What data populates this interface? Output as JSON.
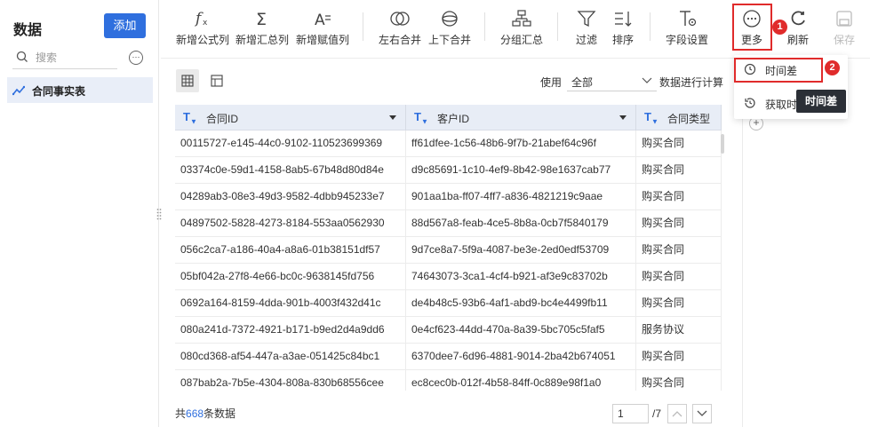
{
  "sidebar": {
    "title": "数据",
    "add_label": "添加",
    "search_placeholder": "搜索",
    "more_glyph": "···",
    "item_label": "合同事实表"
  },
  "toolbar": {
    "new_formula": "新增公式列",
    "new_summary": "新增汇总列",
    "new_assign": "新增赋值列",
    "lr_merge": "左右合并",
    "ud_merge": "上下合并",
    "group_summary": "分组汇总",
    "filter": "过滤",
    "sort": "排序",
    "field_settings": "字段设置",
    "more": "更多",
    "refresh": "刷新",
    "save": "保存"
  },
  "badges": {
    "b1": "1",
    "b2": "2"
  },
  "dropdown": {
    "time_diff": "时间差",
    "get_time": "获取时间"
  },
  "tooltip": "时间差",
  "filter_bar": {
    "use_label": "使用",
    "select_value": "全部",
    "calc_label": "数据进行计算"
  },
  "table": {
    "type_glyph": "T",
    "headers": [
      "合同ID",
      "客户ID",
      "合同类型"
    ],
    "rows": [
      [
        "00115727-e145-44c0-9102-110523699369",
        "ff61dfee-1c56-48b6-9f7b-21abef64c96f",
        "购买合同"
      ],
      [
        "03374c0e-59d1-4158-8ab5-67b48d80d84e",
        "d9c85691-1c10-4ef9-8b42-98e1637cab77",
        "购买合同"
      ],
      [
        "04289ab3-08e3-49d3-9582-4dbb945233e7",
        "901aa1ba-ff07-4ff7-a836-4821219c9aae",
        "购买合同"
      ],
      [
        "04897502-5828-4273-8184-553aa0562930",
        "88d567a8-feab-4ce5-8b8a-0cb7f5840179",
        "购买合同"
      ],
      [
        "056c2ca7-a186-40a4-a8a6-01b38151df57",
        "9d7ce8a7-5f9a-4087-be3e-2ed0edf53709",
        "购买合同"
      ],
      [
        "05bf042a-27f8-4e66-bc0c-9638145fd756",
        "74643073-3ca1-4cf4-b921-af3e9c83702b",
        "购买合同"
      ],
      [
        "0692a164-8159-4dda-901b-4003f432d41c",
        "de4b48c5-93b6-4af1-abd9-bc4e4499fb11",
        "购买合同"
      ],
      [
        "080a241d-7372-4921-b171-b9ed2d4a9dd6",
        "0e4cf623-44dd-470a-8a39-5bc705c5faf5",
        "服务协议"
      ],
      [
        "080cd368-af54-447a-a3ae-051425c84bc1",
        "6370dee7-6d96-4881-9014-2ba42b674051",
        "购买合同"
      ],
      [
        "087bab2a-7b5e-4304-808a-830b68556cee",
        "ec8cec0b-012f-4b58-84ff-0c889e98f1a0",
        "购买合同"
      ]
    ]
  },
  "footer": {
    "prefix": "共",
    "count": "668",
    "suffix": "条数据",
    "page": "1",
    "total_pages": "/7"
  },
  "colors": {
    "accent": "#2f6fde",
    "highlight_red": "#e02b2b",
    "header_bg": "#e8edf6"
  }
}
